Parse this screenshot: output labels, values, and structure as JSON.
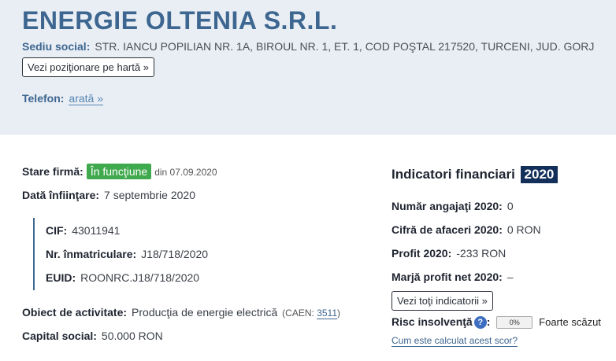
{
  "company": {
    "name": "ENERGIE OLTENIA S.R.L.",
    "address_label": "Sediu social:",
    "address": "STR. IANCU POPILIAN NR. 1A, BIROUL NR. 1, ET. 1, COD POŞTAL 217520, TURCENI, JUD. GORJ",
    "map_button": "Vezi poziţionare pe hartă »",
    "phone_label": "Telefon:",
    "phone_link": "arată »"
  },
  "details": {
    "status_label": "Stare firmă:",
    "status_badge": "În funcţiune",
    "status_since": "din 07.09.2020",
    "founded_label": "Dată înfiinţare:",
    "founded_value": "7 septembrie 2020",
    "cif_label": "CIF:",
    "cif_value": "43011941",
    "reg_label": "Nr. înmatriculare:",
    "reg_value": "J18/718/2020",
    "euid_label": "EUID:",
    "euid_value": "ROONRC.J18/718/2020",
    "activity_label": "Obiect de activitate:",
    "activity_value": "Producţia de energie electrică",
    "caen_prefix": "(CAEN:",
    "caen_code": "3511",
    "caen_suffix": ")",
    "capital_label": "Capital social:",
    "capital_value": "50.000 RON"
  },
  "financial": {
    "title": "Indicatori financiari",
    "year": "2020",
    "employees_label": "Număr angajaţi 2020:",
    "employees_value": "0",
    "turnover_label": "Cifră de afaceri 2020:",
    "turnover_value": "0 RON",
    "profit_label": "Profit 2020:",
    "profit_value": "-233 RON",
    "margin_label": "Marjă profit net 2020:",
    "margin_value": "–",
    "all_indicators_button": "Vezi toţi indicatorii »",
    "risk_label": "Risc insolvenţă",
    "risk_help": "?",
    "risk_colon": ":",
    "risk_percent": "0%",
    "risk_fraction": 0,
    "risk_text": "Foarte scăzut",
    "score_link": "Cum este calculat acest scor?"
  },
  "colors": {
    "brand": "#3d6690",
    "status_green": "#3fa94d",
    "year_badge": "#13305a",
    "header_bg": "#e9eef4"
  }
}
